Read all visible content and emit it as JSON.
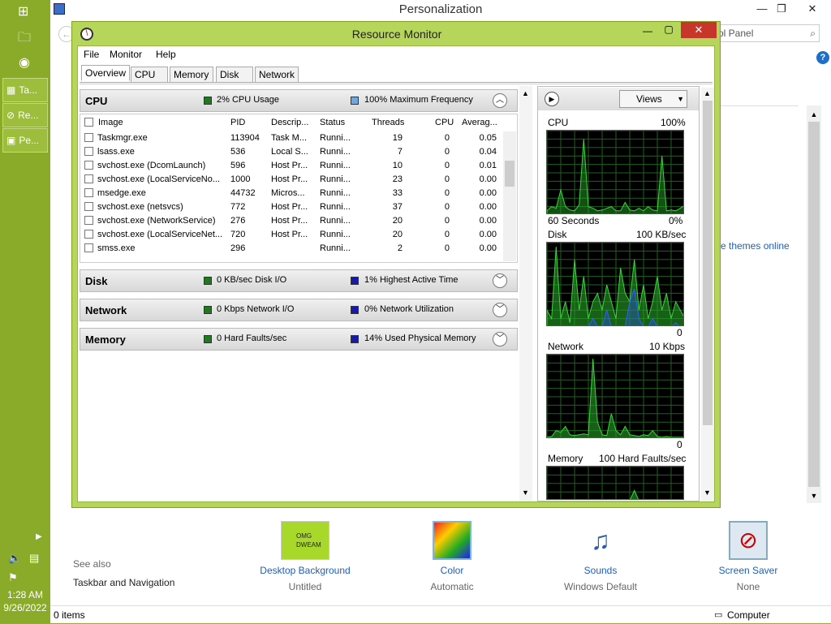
{
  "personalization": {
    "title": "Personalization",
    "search_placeholder": "ol Panel",
    "link_themes": "re themes online",
    "see_also": {
      "heading": "See also",
      "link": "Taskbar and Navigation"
    },
    "bottom_items": [
      {
        "label": "Desktop Background",
        "sub": "Untitled",
        "thumb_text": "OMG DWEAM"
      },
      {
        "label": "Color",
        "sub": "Automatic"
      },
      {
        "label": "Sounds",
        "sub": "Windows Default"
      },
      {
        "label": "Screen Saver",
        "sub": "None"
      }
    ],
    "status_left": "0 items",
    "status_right": "Computer"
  },
  "taskbar": {
    "buttons": [
      {
        "label": "Ta..."
      },
      {
        "label": "Re..."
      },
      {
        "label": "Pe..."
      }
    ],
    "time": "1:28 AM",
    "date": "9/26/2022"
  },
  "resource_monitor": {
    "title": "Resource Monitor",
    "menu": [
      "File",
      "Monitor",
      "Help"
    ],
    "tabs": [
      "Overview",
      "CPU",
      "Memory",
      "Disk",
      "Network"
    ],
    "cpu": {
      "name": "CPU",
      "stat1": "2% CPU Usage",
      "stat2": "100% Maximum Frequency"
    },
    "columns": [
      "Image",
      "PID",
      "Descrip...",
      "Status",
      "Threads",
      "CPU",
      "Averag..."
    ],
    "rows": [
      {
        "image": "Taskmgr.exe",
        "pid": "113904",
        "desc": "Task M...",
        "status": "Runni...",
        "threads": "19",
        "cpu": "0",
        "avg": "0.05"
      },
      {
        "image": "lsass.exe",
        "pid": "536",
        "desc": "Local S...",
        "status": "Runni...",
        "threads": "7",
        "cpu": "0",
        "avg": "0.04"
      },
      {
        "image": "svchost.exe (DcomLaunch)",
        "pid": "596",
        "desc": "Host Pr...",
        "status": "Runni...",
        "threads": "10",
        "cpu": "0",
        "avg": "0.01"
      },
      {
        "image": "svchost.exe (LocalServiceNo...",
        "pid": "1000",
        "desc": "Host Pr...",
        "status": "Runni...",
        "threads": "23",
        "cpu": "0",
        "avg": "0.00"
      },
      {
        "image": "msedge.exe",
        "pid": "44732",
        "desc": "Micros...",
        "status": "Runni...",
        "threads": "33",
        "cpu": "0",
        "avg": "0.00"
      },
      {
        "image": "svchost.exe (netsvcs)",
        "pid": "772",
        "desc": "Host Pr...",
        "status": "Runni...",
        "threads": "37",
        "cpu": "0",
        "avg": "0.00"
      },
      {
        "image": "svchost.exe (NetworkService)",
        "pid": "276",
        "desc": "Host Pr...",
        "status": "Runni...",
        "threads": "20",
        "cpu": "0",
        "avg": "0.00"
      },
      {
        "image": "svchost.exe (LocalServiceNet...",
        "pid": "720",
        "desc": "Host Pr...",
        "status": "Runni...",
        "threads": "20",
        "cpu": "0",
        "avg": "0.00"
      },
      {
        "image": "smss.exe",
        "pid": "296",
        "desc": "",
        "status": "Runni...",
        "threads": "2",
        "cpu": "0",
        "avg": "0.00"
      }
    ],
    "disk": {
      "name": "Disk",
      "stat1": "0 KB/sec Disk I/O",
      "stat2": "1% Highest Active Time"
    },
    "network": {
      "name": "Network",
      "stat1": "0 Kbps Network I/O",
      "stat2": "0% Network Utilization"
    },
    "memory": {
      "name": "Memory",
      "stat1": "0 Hard Faults/sec",
      "stat2": "14% Used Physical Memory"
    },
    "views_label": "Views",
    "graphs": {
      "cpu": {
        "label": "CPU",
        "max": "100%",
        "time": "60 Seconds",
        "min": "0%"
      },
      "disk": {
        "label": "Disk",
        "max": "100 KB/sec",
        "min": "0"
      },
      "network": {
        "label": "Network",
        "max": "10 Kbps",
        "min": "0"
      },
      "memory": {
        "label": "Memory",
        "max": "100 Hard Faults/sec"
      }
    },
    "colors": {
      "green_stat": "#1e7a1e",
      "blue_stat": "#1a1aa8",
      "graph_line": "#3cd43c"
    }
  }
}
